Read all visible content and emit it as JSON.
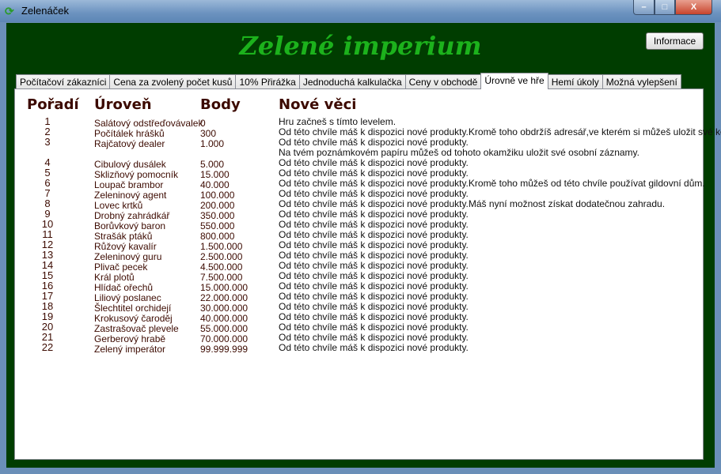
{
  "window": {
    "title": "Zelenáček",
    "min": "–",
    "max": "□",
    "close": "X"
  },
  "header": {
    "logo": "Zelené imperium",
    "info_button": "Informace"
  },
  "tabs": [
    "Počítačoví zákazníci",
    "Cena za zvolený počet kusů",
    "10% Přirážka",
    "Jednoduchá kalkulačka",
    "Ceny v obchodě",
    "Úrovně ve hře",
    "Hemí úkoly",
    "Možná vylepšení"
  ],
  "active_tab": 5,
  "columns": {
    "rank": "Pořadí",
    "level": "Úroveň",
    "points": "Body",
    "new": "Nové věci"
  },
  "levels": [
    {
      "rank": "1",
      "name": "Salátový odstřeďovávalek",
      "points": "0"
    },
    {
      "rank": "2",
      "name": "Počítálek hrášků",
      "points": "300"
    },
    {
      "rank": "3",
      "name": "Rajčatový dealer",
      "points": "1.000"
    },
    {
      "rank": "4",
      "name": "Cibulový dusálek",
      "points": "5.000"
    },
    {
      "rank": "5",
      "name": "Sklizňový pomocník",
      "points": "15.000"
    },
    {
      "rank": "6",
      "name": "Loupač brambor",
      "points": "40.000"
    },
    {
      "rank": "7",
      "name": "Zeleninový agent",
      "points": "100.000"
    },
    {
      "rank": "8",
      "name": "Lovec krtků",
      "points": "200.000"
    },
    {
      "rank": "9",
      "name": "Drobný zahrádkář",
      "points": "350.000"
    },
    {
      "rank": "10",
      "name": "Borůvkový baron",
      "points": "550.000"
    },
    {
      "rank": "11",
      "name": "Strašák ptáků",
      "points": "800.000"
    },
    {
      "rank": "12",
      "name": "Růžový kavalír",
      "points": "1.500.000"
    },
    {
      "rank": "13",
      "name": "Zeleninový guru",
      "points": "2.500.000"
    },
    {
      "rank": "14",
      "name": "Plivač pecek",
      "points": "4.500.000"
    },
    {
      "rank": "15",
      "name": "Král plotů",
      "points": "7.500.000"
    },
    {
      "rank": "16",
      "name": "Hlídač ořechů",
      "points": "15.000.000"
    },
    {
      "rank": "17",
      "name": "Liliový poslanec",
      "points": "22.000.000"
    },
    {
      "rank": "18",
      "name": "Šlechtitel orchidejí",
      "points": "30.000.000"
    },
    {
      "rank": "19",
      "name": "Krokusový čaroděj",
      "points": "40.000.000"
    },
    {
      "rank": "20",
      "name": "Zastrašovač plevele",
      "points": "55.000.000"
    },
    {
      "rank": "21",
      "name": "Gerberový hrabě",
      "points": "70.000.000"
    },
    {
      "rank": "22",
      "name": "Zelený imperátor",
      "points": "99.999.999"
    }
  ],
  "descriptions": [
    "Hru začneš s tímto levelem.",
    "Od této chvíle máš k dispozici nové produkty.Kromě toho obdržíš adresář,ve kterém si můžeš uložit své kontakty.",
    "Od této chvíle máš k dispozici nové produkty.",
    "Na tvém poznámkovém papíru můžeš od tohoto okamžiku uložit své osobní záznamy.",
    "Od této chvíle máš k dispozici nové produkty.",
    "Od této chvíle máš k dispozici nové produkty.",
    "Od této chvíle máš k dispozici nové produkty.Kromě toho můžeš od této chvíle používat gildovní dům.",
    "Od této chvíle máš k dispozici nové produkty.",
    "Od této chvíle máš k dispozici nové produkty.Máš nyní možnost získat dodatečnou zahradu.",
    "Od této chvíle máš k dispozici nové produkty.",
    "Od této chvíle máš k dispozici nové produkty.",
    "Od této chvíle máš k dispozici nové produkty.",
    "Od této chvíle máš k dispozici nové produkty.",
    "Od této chvíle máš k dispozici nové produkty.",
    "Od této chvíle máš k dispozici nové produkty.",
    "Od této chvíle máš k dispozici nové produkty.",
    "Od této chvíle máš k dispozici nové produkty.",
    "Od této chvíle máš k dispozici nové produkty.",
    "Od této chvíle máš k dispozici nové produkty.",
    "Od této chvíle máš k dispozici nové produkty.",
    "Od této chvíle máš k dispozici nové produkty.",
    "Od této chvíle máš k dispozici nové produkty.",
    "Od této chvíle máš k dispozici nové produkty."
  ]
}
